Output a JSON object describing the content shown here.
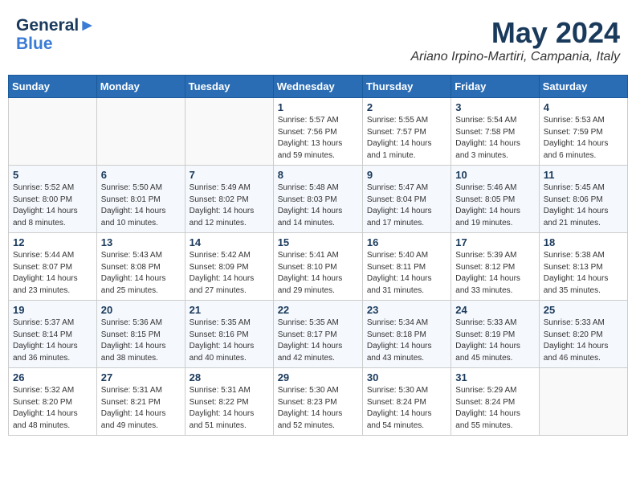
{
  "header": {
    "logo_line1": "General",
    "logo_line2": "Blue",
    "month_year": "May 2024",
    "location": "Ariano Irpino-Martiri, Campania, Italy"
  },
  "weekdays": [
    "Sunday",
    "Monday",
    "Tuesday",
    "Wednesday",
    "Thursday",
    "Friday",
    "Saturday"
  ],
  "weeks": [
    [
      {
        "day": "",
        "info": ""
      },
      {
        "day": "",
        "info": ""
      },
      {
        "day": "",
        "info": ""
      },
      {
        "day": "1",
        "info": "Sunrise: 5:57 AM\nSunset: 7:56 PM\nDaylight: 13 hours\nand 59 minutes."
      },
      {
        "day": "2",
        "info": "Sunrise: 5:55 AM\nSunset: 7:57 PM\nDaylight: 14 hours\nand 1 minute."
      },
      {
        "day": "3",
        "info": "Sunrise: 5:54 AM\nSunset: 7:58 PM\nDaylight: 14 hours\nand 3 minutes."
      },
      {
        "day": "4",
        "info": "Sunrise: 5:53 AM\nSunset: 7:59 PM\nDaylight: 14 hours\nand 6 minutes."
      }
    ],
    [
      {
        "day": "5",
        "info": "Sunrise: 5:52 AM\nSunset: 8:00 PM\nDaylight: 14 hours\nand 8 minutes."
      },
      {
        "day": "6",
        "info": "Sunrise: 5:50 AM\nSunset: 8:01 PM\nDaylight: 14 hours\nand 10 minutes."
      },
      {
        "day": "7",
        "info": "Sunrise: 5:49 AM\nSunset: 8:02 PM\nDaylight: 14 hours\nand 12 minutes."
      },
      {
        "day": "8",
        "info": "Sunrise: 5:48 AM\nSunset: 8:03 PM\nDaylight: 14 hours\nand 14 minutes."
      },
      {
        "day": "9",
        "info": "Sunrise: 5:47 AM\nSunset: 8:04 PM\nDaylight: 14 hours\nand 17 minutes."
      },
      {
        "day": "10",
        "info": "Sunrise: 5:46 AM\nSunset: 8:05 PM\nDaylight: 14 hours\nand 19 minutes."
      },
      {
        "day": "11",
        "info": "Sunrise: 5:45 AM\nSunset: 8:06 PM\nDaylight: 14 hours\nand 21 minutes."
      }
    ],
    [
      {
        "day": "12",
        "info": "Sunrise: 5:44 AM\nSunset: 8:07 PM\nDaylight: 14 hours\nand 23 minutes."
      },
      {
        "day": "13",
        "info": "Sunrise: 5:43 AM\nSunset: 8:08 PM\nDaylight: 14 hours\nand 25 minutes."
      },
      {
        "day": "14",
        "info": "Sunrise: 5:42 AM\nSunset: 8:09 PM\nDaylight: 14 hours\nand 27 minutes."
      },
      {
        "day": "15",
        "info": "Sunrise: 5:41 AM\nSunset: 8:10 PM\nDaylight: 14 hours\nand 29 minutes."
      },
      {
        "day": "16",
        "info": "Sunrise: 5:40 AM\nSunset: 8:11 PM\nDaylight: 14 hours\nand 31 minutes."
      },
      {
        "day": "17",
        "info": "Sunrise: 5:39 AM\nSunset: 8:12 PM\nDaylight: 14 hours\nand 33 minutes."
      },
      {
        "day": "18",
        "info": "Sunrise: 5:38 AM\nSunset: 8:13 PM\nDaylight: 14 hours\nand 35 minutes."
      }
    ],
    [
      {
        "day": "19",
        "info": "Sunrise: 5:37 AM\nSunset: 8:14 PM\nDaylight: 14 hours\nand 36 minutes."
      },
      {
        "day": "20",
        "info": "Sunrise: 5:36 AM\nSunset: 8:15 PM\nDaylight: 14 hours\nand 38 minutes."
      },
      {
        "day": "21",
        "info": "Sunrise: 5:35 AM\nSunset: 8:16 PM\nDaylight: 14 hours\nand 40 minutes."
      },
      {
        "day": "22",
        "info": "Sunrise: 5:35 AM\nSunset: 8:17 PM\nDaylight: 14 hours\nand 42 minutes."
      },
      {
        "day": "23",
        "info": "Sunrise: 5:34 AM\nSunset: 8:18 PM\nDaylight: 14 hours\nand 43 minutes."
      },
      {
        "day": "24",
        "info": "Sunrise: 5:33 AM\nSunset: 8:19 PM\nDaylight: 14 hours\nand 45 minutes."
      },
      {
        "day": "25",
        "info": "Sunrise: 5:33 AM\nSunset: 8:20 PM\nDaylight: 14 hours\nand 46 minutes."
      }
    ],
    [
      {
        "day": "26",
        "info": "Sunrise: 5:32 AM\nSunset: 8:20 PM\nDaylight: 14 hours\nand 48 minutes."
      },
      {
        "day": "27",
        "info": "Sunrise: 5:31 AM\nSunset: 8:21 PM\nDaylight: 14 hours\nand 49 minutes."
      },
      {
        "day": "28",
        "info": "Sunrise: 5:31 AM\nSunset: 8:22 PM\nDaylight: 14 hours\nand 51 minutes."
      },
      {
        "day": "29",
        "info": "Sunrise: 5:30 AM\nSunset: 8:23 PM\nDaylight: 14 hours\nand 52 minutes."
      },
      {
        "day": "30",
        "info": "Sunrise: 5:30 AM\nSunset: 8:24 PM\nDaylight: 14 hours\nand 54 minutes."
      },
      {
        "day": "31",
        "info": "Sunrise: 5:29 AM\nSunset: 8:24 PM\nDaylight: 14 hours\nand 55 minutes."
      },
      {
        "day": "",
        "info": ""
      }
    ]
  ]
}
